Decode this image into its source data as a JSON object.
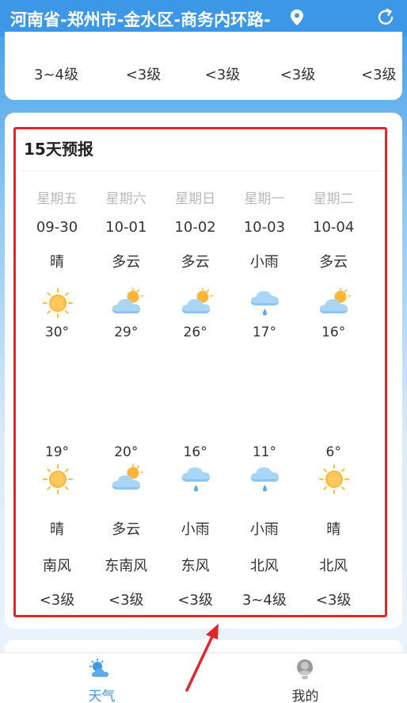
{
  "header": {
    "location": "河南省-郑州市-金水区-商务内环路-",
    "location_icon": "location-pin-icon",
    "refresh_icon": "refresh-icon"
  },
  "top_card": {
    "wind_levels": [
      "3~4级",
      "<3级",
      "<3级",
      "<3级",
      "<3级"
    ]
  },
  "forecast": {
    "title": "15天预报",
    "days": [
      {
        "weekday": "星期五",
        "date": "09-30",
        "day_condition": "晴",
        "day_icon": "sunny-icon",
        "high": "30°",
        "low": "19°",
        "night_icon": "sunny-icon",
        "night_condition": "晴",
        "wind_dir": "南风",
        "wind_level": "<3级"
      },
      {
        "weekday": "星期六",
        "date": "10-01",
        "day_condition": "多云",
        "day_icon": "partly-cloudy-icon",
        "high": "29°",
        "low": "20°",
        "night_icon": "partly-cloudy-icon",
        "night_condition": "多云",
        "wind_dir": "东南风",
        "wind_level": "<3级"
      },
      {
        "weekday": "星期日",
        "date": "10-02",
        "day_condition": "多云",
        "day_icon": "partly-cloudy-icon",
        "high": "26°",
        "low": "16°",
        "night_icon": "light-rain-icon",
        "night_condition": "小雨",
        "wind_dir": "东风",
        "wind_level": "<3级"
      },
      {
        "weekday": "星期一",
        "date": "10-03",
        "day_condition": "小雨",
        "day_icon": "light-rain-icon",
        "high": "17°",
        "low": "11°",
        "night_icon": "light-rain-icon",
        "night_condition": "小雨",
        "wind_dir": "北风",
        "wind_level": "3~4级"
      },
      {
        "weekday": "星期二",
        "date": "10-04",
        "day_condition": "多云",
        "day_icon": "partly-cloudy-icon",
        "high": "16°",
        "low": "6°",
        "night_icon": "sunny-icon",
        "night_condition": "晴",
        "wind_dir": "北风",
        "wind_level": "<3级"
      }
    ]
  },
  "tabs": [
    {
      "label": "天气",
      "icon": "weather-tab-icon",
      "active": true,
      "color": "#3c97e6"
    },
    {
      "label": "我的",
      "icon": "profile-tab-icon",
      "active": false,
      "color": "#333333"
    }
  ],
  "colors": {
    "accent": "#3c97e6",
    "highlight_border": "#e2262a",
    "arrow": "#e2262a"
  }
}
